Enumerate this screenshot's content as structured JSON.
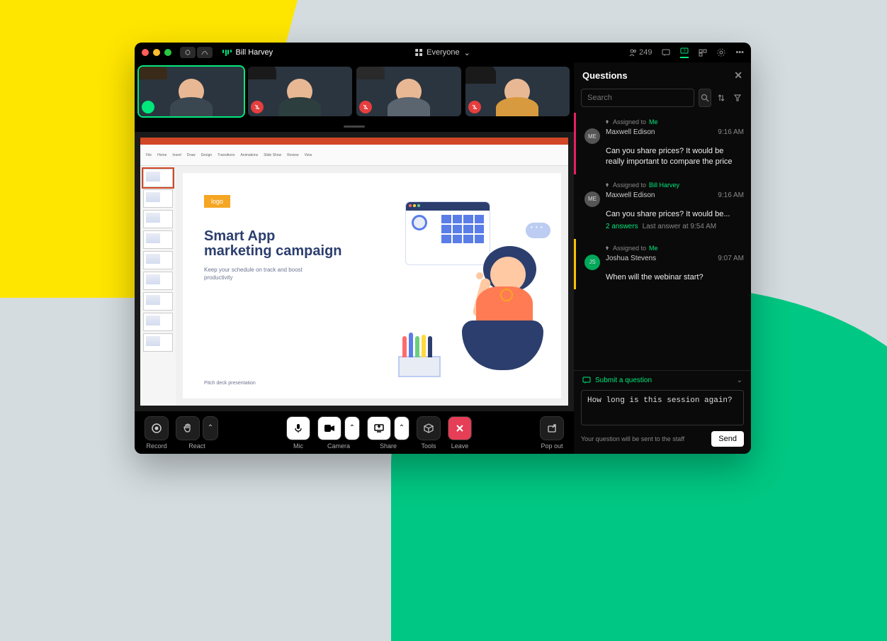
{
  "titlebar": {
    "username": "Bill Harvey"
  },
  "layout_switcher": {
    "label": "Everyone"
  },
  "top": {
    "participant_count": "249"
  },
  "panel": {
    "title": "Questions",
    "search_placeholder": "Search",
    "submit_label": "Submit a question",
    "input_value": "How long is this session again?",
    "footer_hint": "Your question will be sent to the staff",
    "send_label": "Send"
  },
  "questions": [
    {
      "assigned_label": "Assigned to",
      "assigned_to": "Me",
      "avatar": "ME",
      "name": "Maxwell Edison",
      "time": "9:16 AM",
      "text": "Can you share prices? It would be really important to compare the price"
    },
    {
      "assigned_label": "Assigned to",
      "assigned_to": "Bill Harvey",
      "avatar": "ME",
      "name": "Maxwell Edison",
      "time": "9:16 AM",
      "text": "Can you share prices? It would be...",
      "answers": "2 answers",
      "answers_time": "Last answer at 9:54 AM"
    },
    {
      "assigned_label": "Assigned to",
      "assigned_to": "Me",
      "avatar": "JS",
      "name": "Joshua Stevens",
      "time": "9:07 AM",
      "text": "When will the webinar start?"
    }
  ],
  "slide": {
    "logo": "logo",
    "title": "Smart App marketing campaign",
    "subtitle": "Keep your schedule on track and boost productivity",
    "footer": "Pitch deck presentation"
  },
  "controls": {
    "record": "Record",
    "react": "React",
    "mic": "Mic",
    "camera": "Camera",
    "share": "Share",
    "tools": "Tools",
    "leave": "Leave",
    "popout": "Pop out"
  }
}
